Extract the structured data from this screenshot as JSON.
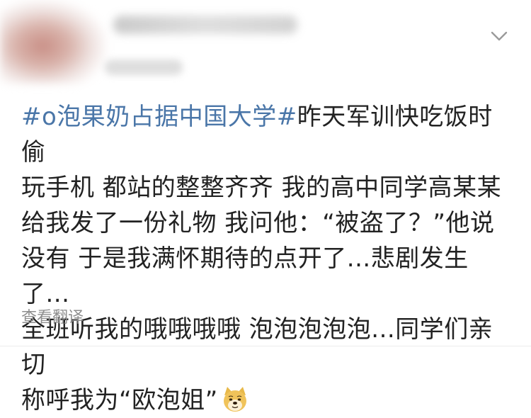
{
  "post": {
    "hashtag": "#o泡果奶占据中国大学#",
    "body_line1": "昨天军训快吃饭时偷",
    "body_rest": "玩手机 都站的整整齐齐 我的高中同学高某某\n给我发了一份礼物 我问他：“被盗了？”他说\n没有 于是我满怀期待的点开了...悲剧发生了...\n全班听我的哦哦哦哦 泡泡泡泡泡...同学们亲切\n称呼我为“欧泡姐”",
    "emoji": "doge-emoji"
  },
  "actions": {
    "translate_label": "查看翻译"
  },
  "icons": {
    "more": "chevron-down-icon"
  },
  "colors": {
    "hashtag": "#4a76a8",
    "text": "#222222",
    "muted": "#8e8e8e"
  }
}
